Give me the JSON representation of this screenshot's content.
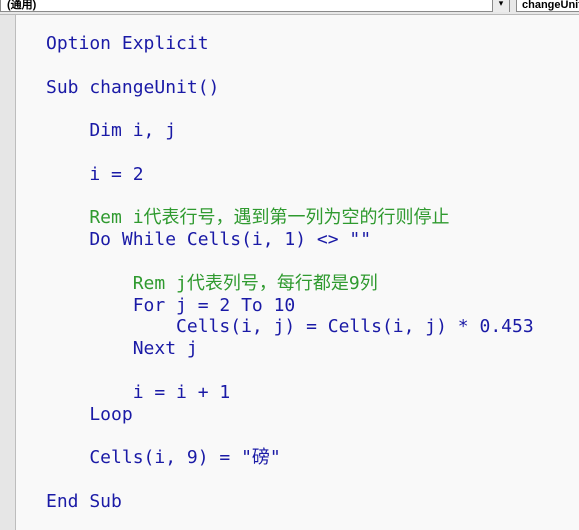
{
  "toolbar": {
    "object_combo": "(通用)",
    "procedure_combo": "changeUnit",
    "dropdown_glyph": "▾"
  },
  "code_lines": [
    {
      "type": "kw",
      "text": "Option Explicit"
    },
    {
      "type": "blank",
      "text": ""
    },
    {
      "type": "kw",
      "text": "Sub changeUnit()"
    },
    {
      "type": "blank",
      "text": ""
    },
    {
      "type": "kw",
      "text": "    Dim i, j"
    },
    {
      "type": "blank",
      "text": ""
    },
    {
      "type": "plain",
      "text": "    i = 2"
    },
    {
      "type": "blank",
      "text": ""
    },
    {
      "type": "cmt",
      "text": "    Rem i代表行号，遇到第一列为空的行则停止"
    },
    {
      "type": "kw",
      "text": "    Do While Cells(i, 1) <> \"\""
    },
    {
      "type": "blank",
      "text": ""
    },
    {
      "type": "cmt",
      "text": "        Rem j代表列号，每行都是9列"
    },
    {
      "type": "kw",
      "text": "        For j = 2 To 10"
    },
    {
      "type": "plain",
      "text": "            Cells(i, j) = Cells(i, j) * 0.453"
    },
    {
      "type": "kw",
      "text": "        Next j"
    },
    {
      "type": "blank",
      "text": ""
    },
    {
      "type": "plain",
      "text": "        i = i + 1"
    },
    {
      "type": "kw",
      "text": "    Loop"
    },
    {
      "type": "blank",
      "text": ""
    },
    {
      "type": "plain",
      "text": "    Cells(i, 9) = \"磅\""
    },
    {
      "type": "blank",
      "text": ""
    },
    {
      "type": "kw",
      "text": "End Sub"
    }
  ]
}
